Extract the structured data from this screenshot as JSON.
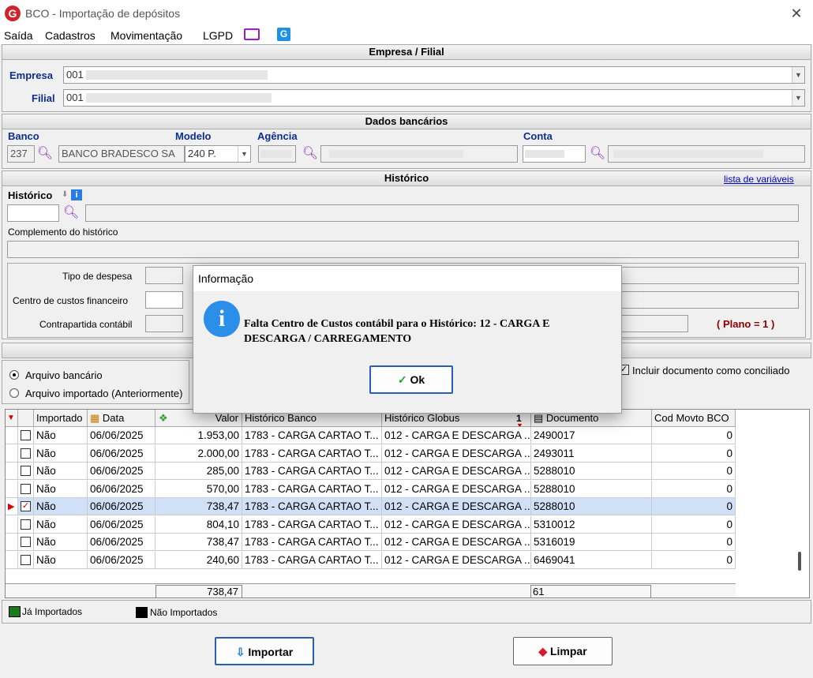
{
  "window": {
    "title": "BCO - Importação de depósitos",
    "close": "✕",
    "app_icon": "G"
  },
  "menu": {
    "items": [
      "Saída",
      "Cadastros",
      "Movimentação",
      "LGPD"
    ],
    "icons": [
      "monitor-icon",
      "globus-app-icon"
    ]
  },
  "empresa_section": {
    "title": "Empresa / Filial",
    "empresa_label": "Empresa",
    "empresa_value": "001",
    "filial_label": "Filial",
    "filial_value": "001"
  },
  "dados_bancarios": {
    "title": "Dados bancários",
    "banco_label": "Banco",
    "banco_code": "237",
    "banco_name": "BANCO BRADESCO SA",
    "modelo_label": "Modelo",
    "modelo_value": "240 P.",
    "agencia_label": "Agência",
    "conta_label": "Conta"
  },
  "historico": {
    "title": "Histórico",
    "link": "lista de variáveis",
    "historico_label": "Histórico",
    "complemento_label": "Complemento do histórico",
    "tipo_despesa_label": "Tipo de despesa",
    "centro_custos_label": "Centro de custos financeiro",
    "contrapartida_label": "Contrapartida contábil",
    "plano": "( Plano = 1 )"
  },
  "options": {
    "arquivo_bancario": "Arquivo bancário",
    "arquivo_importado": "Arquivo importado (Anteriormente)",
    "incluir_label": "Incluir documento como conciliado"
  },
  "grid": {
    "columns": [
      "Importado",
      "Data",
      "Valor",
      "Histórico Banco",
      "Histórico Globus",
      "Documento",
      "Cod Movto BCO"
    ],
    "sort_indicator": "1",
    "rows": [
      {
        "checked": false,
        "importado": "Não",
        "data": "06/06/2025",
        "valor": "1.953,00",
        "hist_banco": "1783 - CARGA CARTAO T...",
        "hist_globus": "012 - CARGA E DESCARGA ...",
        "documento": "2490017",
        "cod": "0"
      },
      {
        "checked": false,
        "importado": "Não",
        "data": "06/06/2025",
        "valor": "2.000,00",
        "hist_banco": "1783 - CARGA CARTAO T...",
        "hist_globus": "012 - CARGA E DESCARGA ...",
        "documento": "2493011",
        "cod": "0"
      },
      {
        "checked": false,
        "importado": "Não",
        "data": "06/06/2025",
        "valor": "285,00",
        "hist_banco": "1783 - CARGA CARTAO T...",
        "hist_globus": "012 - CARGA E DESCARGA ...",
        "documento": "5288010",
        "cod": "0"
      },
      {
        "checked": false,
        "importado": "Não",
        "data": "06/06/2025",
        "valor": "570,00",
        "hist_banco": "1783 - CARGA CARTAO T...",
        "hist_globus": "012 - CARGA E DESCARGA ...",
        "documento": "5288010",
        "cod": "0"
      },
      {
        "checked": true,
        "importado": "Não",
        "data": "06/06/2025",
        "valor": "738,47",
        "hist_banco": "1783 - CARGA CARTAO T...",
        "hist_globus": "012 - CARGA E DESCARGA ...",
        "documento": "5288010",
        "cod": "0"
      },
      {
        "checked": false,
        "importado": "Não",
        "data": "06/06/2025",
        "valor": "804,10",
        "hist_banco": "1783 - CARGA CARTAO T...",
        "hist_globus": "012 - CARGA E DESCARGA ...",
        "documento": "5310012",
        "cod": "0"
      },
      {
        "checked": false,
        "importado": "Não",
        "data": "06/06/2025",
        "valor": "738,47",
        "hist_banco": "1783 - CARGA CARTAO T...",
        "hist_globus": "012 - CARGA E DESCARGA ...",
        "documento": "5316019",
        "cod": "0"
      },
      {
        "checked": false,
        "importado": "Não",
        "data": "06/06/2025",
        "valor": "240,60",
        "hist_banco": "1783 - CARGA CARTAO T...",
        "hist_globus": "012 - CARGA E DESCARGA ...",
        "documento": "6469041",
        "cod": "0"
      }
    ],
    "total_valor": "738,47",
    "total_documentos": "61"
  },
  "legend": {
    "ja_importados": "Já Importados",
    "nao_importados": "Não Importados",
    "ja_color": "#1a7a1a",
    "nao_color": "#000000"
  },
  "buttons": {
    "importar": "Importar",
    "limpar": "Limpar"
  },
  "dialog": {
    "title": "Informação",
    "message": "Falta Centro de Custos contábil para o Histórico: 12 - CARGA E DESCARGA / CARREGAMENTO",
    "ok": "Ok"
  },
  "colors": {
    "selected_row": "#cfe0f7",
    "label_blue": "#0b2e8f",
    "plano_red": "#8b0000"
  }
}
